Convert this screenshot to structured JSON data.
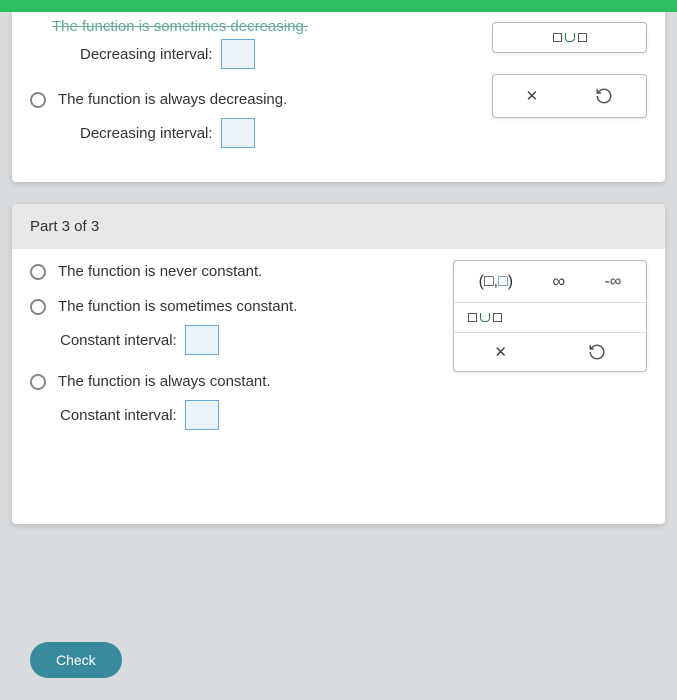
{
  "part2": {
    "truncated_label": "The function is sometimes decreasing.",
    "decreasing_interval_1_label": "Decreasing interval:",
    "always_decreasing_label": "The function is always decreasing.",
    "decreasing_interval_2_label": "Decreasing interval:"
  },
  "part3": {
    "header": "Part 3 of 3",
    "never_constant_label": "The function is never constant.",
    "sometimes_constant_label": "The function is sometimes constant.",
    "constant_interval_1_label": "Constant interval:",
    "always_constant_label": "The function is always constant.",
    "constant_interval_2_label": "Constant interval:"
  },
  "toolbar": {
    "ordered_pair": "(□,□)",
    "infinity": "∞",
    "neg_infinity": "-∞",
    "clear": "✕",
    "reset": "↺"
  },
  "check_button": "Check"
}
